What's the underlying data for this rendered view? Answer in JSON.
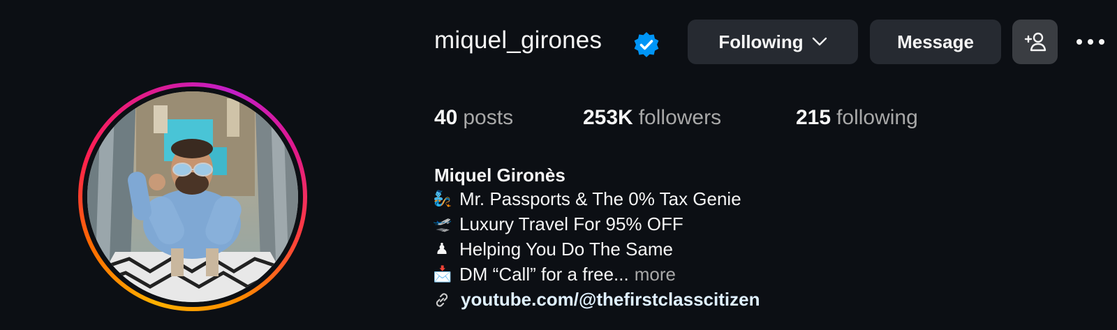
{
  "profile": {
    "username": "miquel_girones",
    "verified": true
  },
  "actions": {
    "following_label": "Following",
    "message_label": "Message"
  },
  "stats": {
    "posts_count": "40",
    "posts_label": "posts",
    "followers_count": "253K",
    "followers_label": "followers",
    "following_count": "215",
    "following_label": "following"
  },
  "bio": {
    "full_name": "Miquel Gironès",
    "lines": [
      {
        "emoji": "🧞",
        "text": "Mr. Passports & The 0% Tax Genie"
      },
      {
        "emoji": "🛫",
        "text": "Luxury Travel For 95% OFF"
      },
      {
        "emoji": "♟",
        "text": "Helping You Do The Same"
      },
      {
        "emoji": "📩",
        "text": "DM “Call” for a free..."
      }
    ],
    "more_label": "more",
    "link": "youtube.com/@thefirstclasscitizen"
  },
  "colors": {
    "background": "#0c0f14",
    "button": "#262a31",
    "verified_blue": "#0095f6",
    "muted_text": "#a8a8a8",
    "link_text": "#e0f1ff"
  },
  "icons": {
    "verified": "verified-badge-icon",
    "chevron": "chevron-down-icon",
    "add_user": "add-person-icon",
    "more": "more-horizontal-icon",
    "link": "link-icon"
  }
}
